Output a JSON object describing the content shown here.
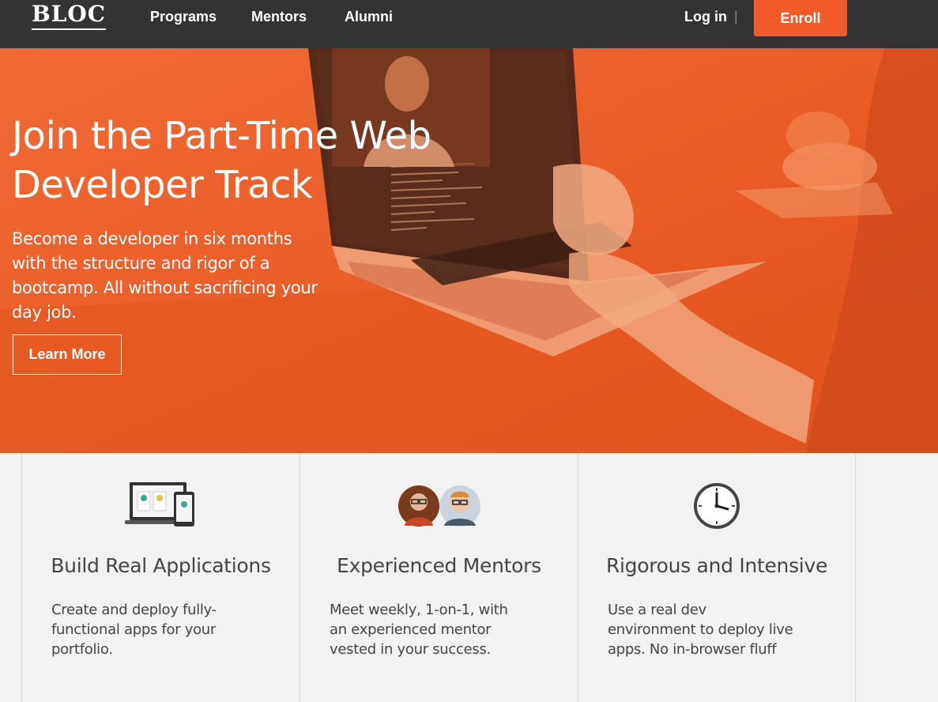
{
  "nav": {
    "logo": "BLOC",
    "links": [
      "Programs",
      "Mentors",
      "Alumni"
    ],
    "login": "Log in",
    "separator": "|",
    "enroll": "Enroll"
  },
  "hero": {
    "title": "Join the Part-Time Web Developer Track",
    "subtitle": "Become a developer in six months with the structure and rigor of a bootcamp. All without sacrificing your day job.",
    "cta": "Learn More"
  },
  "features": [
    {
      "icon": "devices-icon",
      "title": "Build Real Applications",
      "text": "Create and deploy fully-functional apps for your portfolio."
    },
    {
      "icon": "mentors-avatars-icon",
      "title": "Experienced Mentors",
      "text": "Meet weekly, 1-on-1, with an experienced mentor vested in your success."
    },
    {
      "icon": "clock-icon",
      "title": "Rigorous and Intensive",
      "text": "Use a real dev environment to deploy live apps. No in-browser fluff"
    }
  ],
  "colors": {
    "nav_bg": "#333333",
    "accent": "#f25a29",
    "hero_bg": "#ee5c28",
    "features_bg": "#f2f2f2",
    "text": "#444444"
  }
}
